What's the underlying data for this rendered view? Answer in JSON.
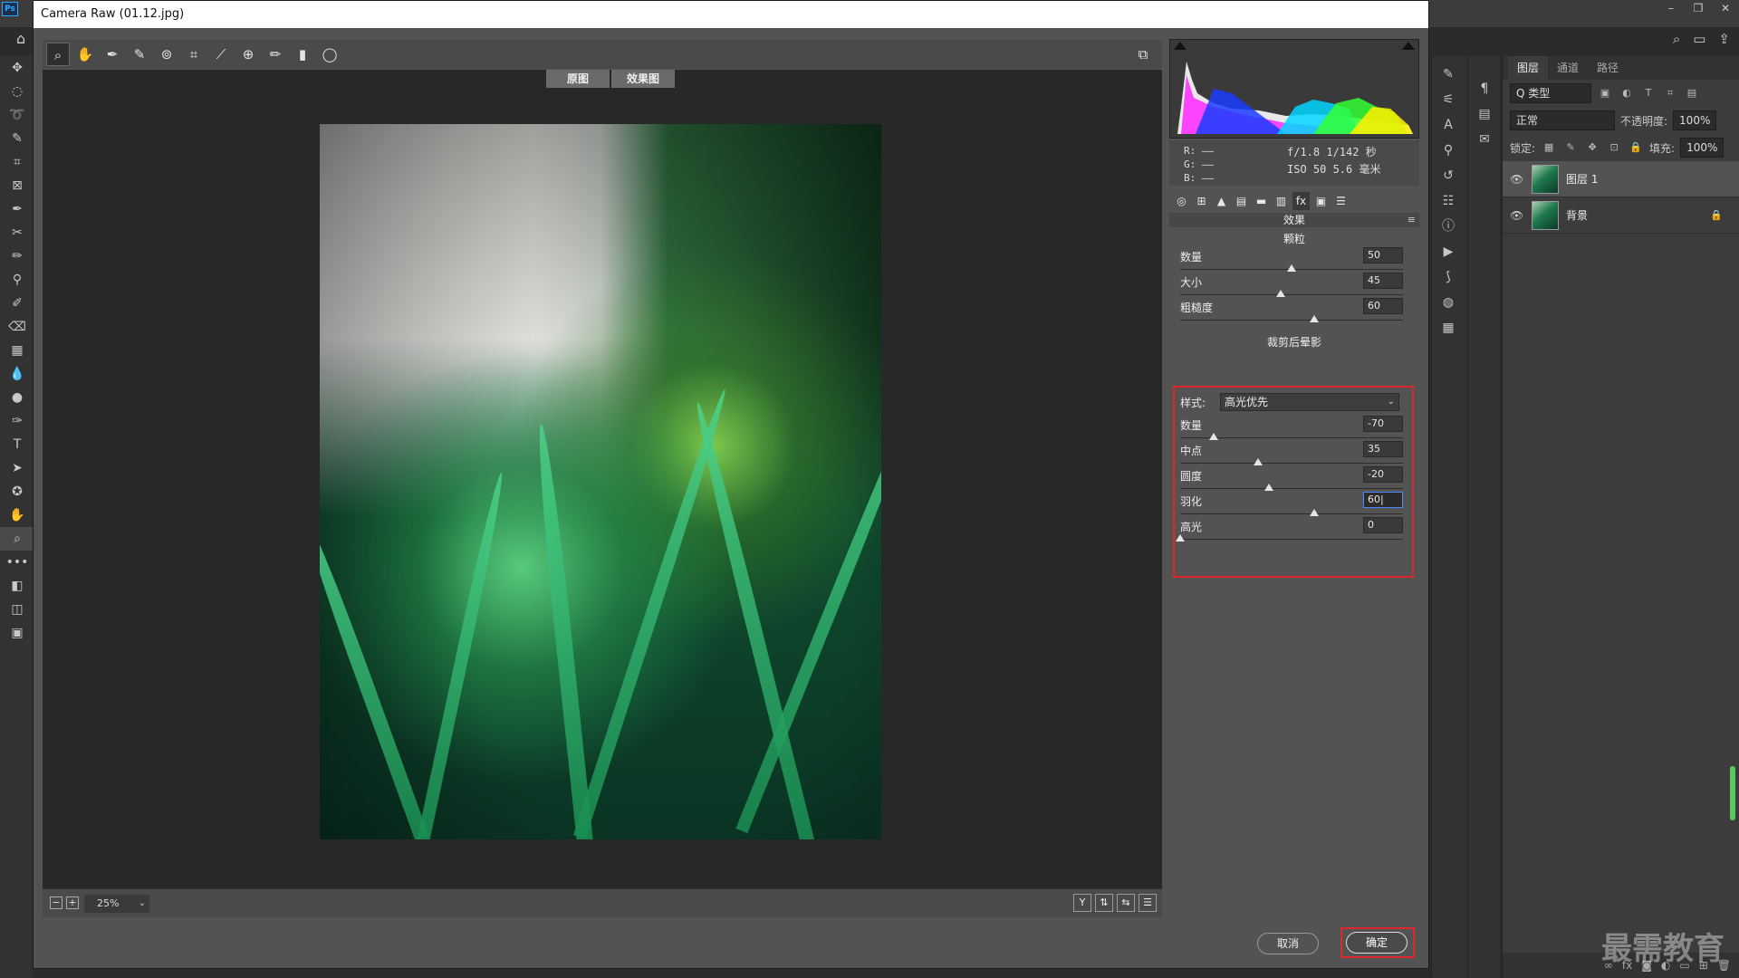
{
  "app": {
    "logo": "Ps",
    "window_controls": [
      "–",
      "❐",
      "✕"
    ]
  },
  "dialog": {
    "title": "Camera Raw (01.12.jpg)",
    "view_toggle": [
      "原图",
      "效果图"
    ],
    "zoom": "25%",
    "histogram_readout": {
      "r": "R:   ——",
      "g": "G:   ——",
      "b": "B:   ——",
      "exif_line1": "f/1.8  1/142 秒",
      "exif_line2": "ISO 50  5.6 毫米"
    },
    "section_header": "效果",
    "grain": {
      "title": "颗粒",
      "sliders": [
        {
          "label": "数量",
          "value": "50",
          "fraction": 0.5
        },
        {
          "label": "大小",
          "value": "45",
          "fraction": 0.45
        },
        {
          "label": "粗糙度",
          "value": "60",
          "fraction": 0.6
        }
      ]
    },
    "vignette": {
      "title": "裁剪后晕影",
      "style_label": "样式:",
      "style_value": "高光优先",
      "sliders": [
        {
          "label": "数量",
          "value": "-70",
          "fraction": 0.15
        },
        {
          "label": "中点",
          "value": "35",
          "fraction": 0.35
        },
        {
          "label": "圆度",
          "value": "-20",
          "fraction": 0.4
        },
        {
          "label": "羽化",
          "value": "60|",
          "fraction": 0.6
        },
        {
          "label": "高光",
          "value": "0",
          "fraction": 0.0
        }
      ]
    },
    "buttons": {
      "cancel": "取消",
      "ok": "确定"
    }
  },
  "layers_panel": {
    "tabs": [
      "图层",
      "通道",
      "路径"
    ],
    "filter_label": "Q 类型",
    "blend_mode": "正常",
    "opacity_label": "不透明度:",
    "opacity_value": "100%",
    "lock_label": "锁定:",
    "fill_label": "填充:",
    "fill_value": "100%",
    "layers": [
      {
        "name": "图层 1",
        "selected": true
      },
      {
        "name": "背景",
        "selected": false
      }
    ]
  },
  "watermark": "最需教育"
}
